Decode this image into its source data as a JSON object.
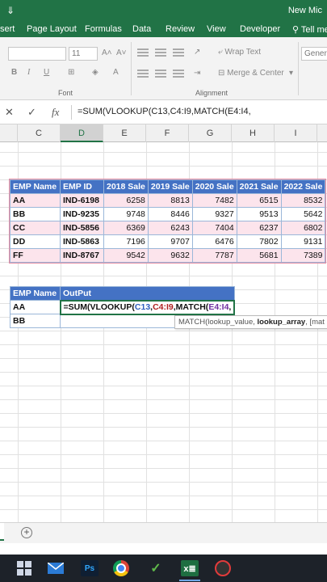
{
  "window": {
    "title": "New Mic",
    "save_glyph": "⇓"
  },
  "ribbon_tabs": [
    "sert",
    "Page Layout",
    "Formulas",
    "Data",
    "Review",
    "View",
    "Developer",
    "Tell me"
  ],
  "ribbon": {
    "font_name": "",
    "font_size": "11",
    "font_label": "Font",
    "alignment_label": "Alignment",
    "wrap_text": "Wrap Text",
    "merge_center": "Merge & Center",
    "number_format": "Genera",
    "bold": "B",
    "italic": "I",
    "underline": "U"
  },
  "formula_bar": {
    "cancel_glyph": "✕",
    "enter_glyph": "✓",
    "fx_glyph": "fx",
    "formula": "=SUM(VLOOKUP(C13,C4:I9,MATCH(E4:I4,"
  },
  "columns": [
    "C",
    "D",
    "E",
    "F",
    "G",
    "H",
    "I"
  ],
  "selected_column": "D",
  "main_table": {
    "headers": [
      "EMP Name",
      "EMP ID",
      "2018 Sale",
      "2019 Sale",
      "2020 Sale",
      "2021 Sale",
      "2022 Sale"
    ],
    "rows": [
      [
        "AA",
        "IND-6198",
        "6258",
        "8813",
        "7482",
        "6515",
        "8532"
      ],
      [
        "BB",
        "IND-9235",
        "9748",
        "8446",
        "9327",
        "9513",
        "5642"
      ],
      [
        "CC",
        "IND-5856",
        "6369",
        "6243",
        "7404",
        "6237",
        "6802"
      ],
      [
        "DD",
        "IND-5863",
        "7196",
        "9707",
        "6476",
        "7802",
        "9131"
      ],
      [
        "FF",
        "IND-8767",
        "9542",
        "9632",
        "7787",
        "5681",
        "7389"
      ]
    ]
  },
  "output_table": {
    "headers": [
      "EMP Name",
      "OutPut"
    ],
    "rows": [
      [
        "AA",
        ""
      ],
      [
        "BB",
        ""
      ]
    ],
    "formula_parts": {
      "p1": "=SUM(VLOOKUP(",
      "p2": "C13",
      "p3": ",",
      "p4": "C4:I9",
      "p5": ",MATCH(",
      "p6": "E4:I4",
      "p7": ","
    }
  },
  "tooltip": {
    "prefix": "MATCH(lookup_value, ",
    "bold": "lookup_array",
    "suffix": ", [mat"
  },
  "sheetbar": {
    "add_glyph": "+"
  },
  "taskbar": {
    "ps_label": "Ps",
    "excel_label": "x≣",
    "camtasia_glyph": "✓"
  },
  "colors": {
    "excel_green": "#217346",
    "header_blue": "#4472c4",
    "row_pink": "#fce4ec"
  }
}
